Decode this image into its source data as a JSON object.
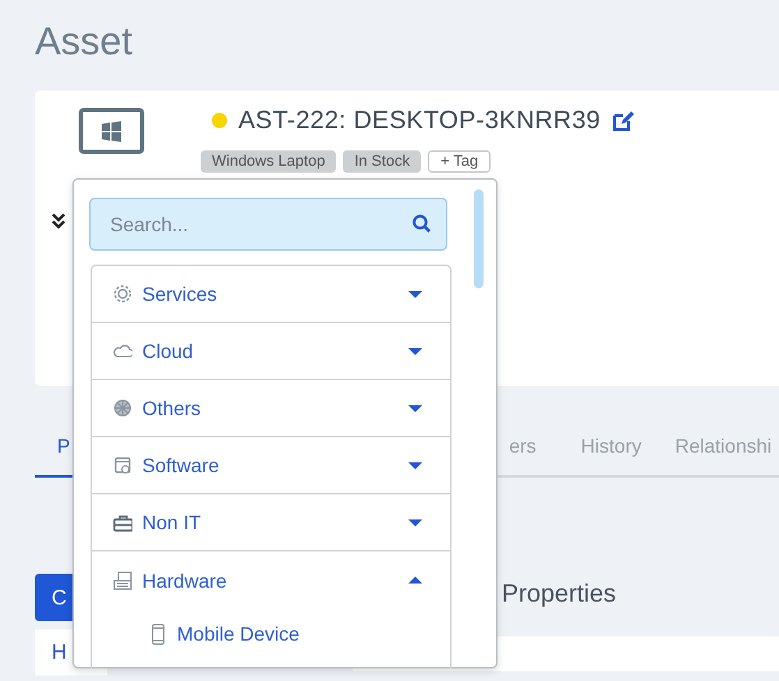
{
  "page": {
    "title": "Asset"
  },
  "asset": {
    "title": "AST-222: DESKTOP-3KNRR39",
    "tags": [
      "Windows Laptop",
      "In Stock"
    ],
    "add_tag": "+ Tag"
  },
  "tabs": [
    {
      "label": "P",
      "selected": true
    },
    {
      "label": "ers",
      "selected": false
    },
    {
      "label": "History",
      "selected": false
    },
    {
      "label": "Relationshi",
      "selected": false
    }
  ],
  "left_panel": {
    "button": "C",
    "item": "H"
  },
  "right_panel": {
    "heading": "Properties"
  },
  "dropdown": {
    "search": {
      "placeholder": "Search..."
    },
    "categories": [
      {
        "label": "Services",
        "expanded": false
      },
      {
        "label": "Cloud",
        "expanded": false
      },
      {
        "label": "Others",
        "expanded": false
      },
      {
        "label": "Software",
        "expanded": false
      },
      {
        "label": "Non IT",
        "expanded": false
      },
      {
        "label": "Hardware",
        "expanded": true,
        "children": [
          {
            "label": "Mobile Device"
          }
        ]
      }
    ]
  }
}
